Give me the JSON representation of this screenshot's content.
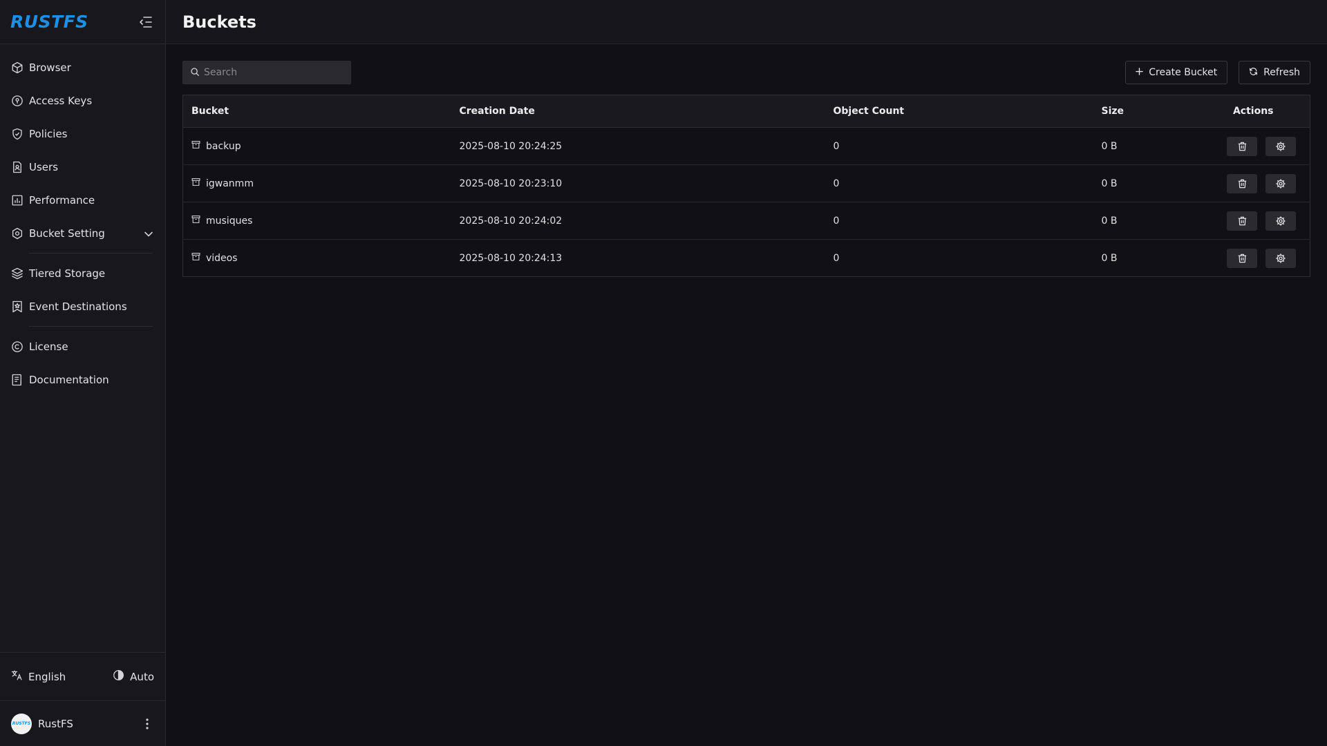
{
  "brand": {
    "logo": "RUSTFS"
  },
  "sidebar": {
    "items": [
      {
        "label": "Browser",
        "icon": "box-icon"
      },
      {
        "label": "Access Keys",
        "icon": "key-icon"
      },
      {
        "label": "Policies",
        "icon": "shield-check-icon"
      },
      {
        "label": "Users",
        "icon": "user-badge-icon"
      },
      {
        "label": "Performance",
        "icon": "chart-icon"
      },
      {
        "label": "Bucket Setting",
        "icon": "gear-icon"
      },
      {
        "label": "Tiered Storage",
        "icon": "layers-icon"
      },
      {
        "label": "Event Destinations",
        "icon": "bookmark-star-icon"
      },
      {
        "label": "License",
        "icon": "copyright-icon"
      },
      {
        "label": "Documentation",
        "icon": "document-icon"
      }
    ],
    "footer": {
      "language": "English",
      "theme": "Auto",
      "user_name": "RustFS",
      "avatar_text": "RUSTFS"
    }
  },
  "header": {
    "title": "Buckets"
  },
  "toolbar": {
    "search_placeholder": "Search",
    "create_label": "Create Bucket",
    "refresh_label": "Refresh"
  },
  "table": {
    "columns": [
      "Bucket",
      "Creation Date",
      "Object Count",
      "Size",
      "Actions"
    ],
    "rows": [
      {
        "name": "backup",
        "created": "2025-08-10 20:24:25",
        "count": "0",
        "size": "0 B"
      },
      {
        "name": "igwanmm",
        "created": "2025-08-10 20:23:10",
        "count": "0",
        "size": "0 B"
      },
      {
        "name": "musiques",
        "created": "2025-08-10 20:24:02",
        "count": "0",
        "size": "0 B"
      },
      {
        "name": "videos",
        "created": "2025-08-10 20:24:13",
        "count": "0",
        "size": "0 B"
      }
    ]
  },
  "colors": {
    "accent": "#1e8fe3",
    "bg": "#111015",
    "sidebar_bg": "#18171c"
  }
}
